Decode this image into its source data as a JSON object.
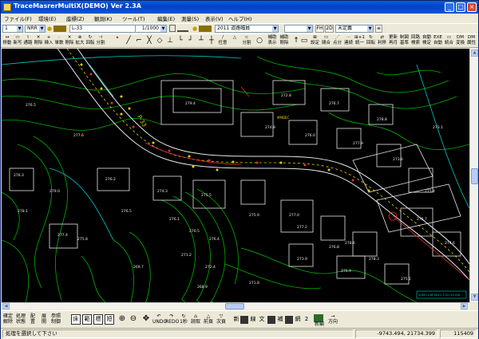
{
  "window": {
    "title": "TraceMasrerMultiX(DEMO) Ver 2.3A"
  },
  "menu": [
    "ファイル(F)",
    "環境(E)",
    "座標(Z)",
    "観測(K)",
    "ツール(T)",
    "編集(E)",
    "測量(S)",
    "表示(V)",
    "ヘルプ(H)"
  ],
  "toolbar1": {
    "num_combo": "1",
    "type_combo": "NRR",
    "layer_combo": "L-33",
    "scale_combo": "1/1000",
    "date_layer_combo": "2011 道路幅員",
    "fh_button": "FH",
    "twod_button": "2D",
    "status_combo": "未定義"
  },
  "toolbar2": {
    "left_tools": [
      "移動",
      "新写",
      "通路",
      "剛除",
      "挿入",
      "単数",
      "剛除",
      "拡大",
      "回転",
      "分割"
    ],
    "shape_tools": [
      "任意",
      "分割"
    ],
    "mid_tools": [
      "補助\n表示",
      "補助\n剛除"
    ],
    "right_tools": [
      "設定",
      "閉合",
      "点分",
      "連続",
      "統一",
      "回転",
      "利移",
      "再月",
      "基準",
      "検索",
      "検定",
      "自動",
      "統合",
      "変換",
      "属性"
    ],
    "right_top": [
      "",
      "",
      "",
      "",
      "⊞+1",
      "",
      "",
      "更新",
      "制図",
      "回路",
      "自動",
      "EXE",
      "",
      "DM",
      "DM"
    ]
  },
  "map": {
    "numbers": [
      "276.5",
      "277.6",
      "279.0",
      "278.1",
      "275.8",
      "276.5",
      "276.1",
      "276.4",
      "275.9",
      "277.2",
      "276.8",
      "278.3",
      "275.1",
      "274.9",
      "276.0",
      "277.9",
      "273.6",
      "275.4",
      "272.8",
      "276.7",
      "278.8",
      "279.4",
      "276.2",
      "274.3",
      "275.5",
      "277.0",
      "278.6",
      "273.9",
      "276.9",
      "275.7",
      "270.5",
      "271.2",
      "272.4",
      "268.9",
      "269.7",
      "273.1",
      "274.6",
      "276.3",
      "277.4",
      "271.8"
    ],
    "road_label": "P-33",
    "callout": "20M=1:M 2011.3 D=10 Km",
    "callout2": "MMDEC"
  },
  "toolbar3": {
    "left_tools": [
      "確定\n解除",
      "処理\n状態",
      "配\n置",
      "展\n開",
      "参照\n制御"
    ],
    "boxes": [
      "床",
      "範",
      "標",
      "短"
    ],
    "zoom_labels": [
      "UNDO",
      "REDO",
      "1秒",
      "読取",
      "前頁",
      "次頁"
    ],
    "mode_labels": [
      "新",
      "線",
      "文",
      "補",
      "網",
      "2"
    ],
    "right_labels": [
      "新編",
      "方向"
    ]
  },
  "status": {
    "message": "処理を選択して下さい",
    "coords": "-9743.494, 21734.399",
    "scale": "115409"
  },
  "colors": {
    "map_bg": "#000000",
    "contour_green": "#00C000",
    "building_white": "#E8E8E8",
    "road_yellow": "#E8D000",
    "accent_red": "#E03030",
    "cyan": "#00C8C8",
    "titlebar": "#0A5EE0"
  }
}
